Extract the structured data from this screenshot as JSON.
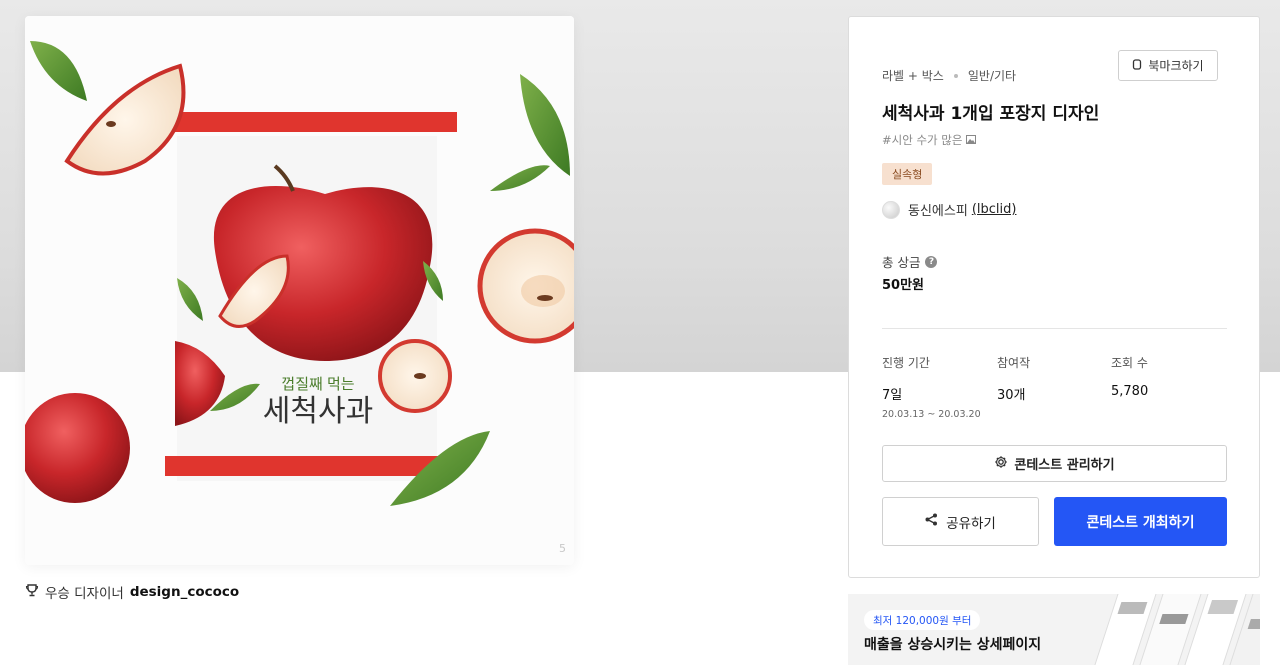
{
  "hero": {
    "package_slogan": "껍질째 먹는",
    "package_name": "세척사과",
    "brand_mark": "5"
  },
  "winner": {
    "label": "우승 디자이너",
    "designer": "design_cococo"
  },
  "contest": {
    "category": "라벨 + 박스",
    "subcategory": "일반/기타",
    "bookmark_label": "북마크하기",
    "title": "세척사과 1개입 포장지 디자인",
    "tagline": "#시안 수가 많은 ",
    "badge": "실속형",
    "host_name": "동신에스피",
    "host_handle": "(lbclid)",
    "prize_label": "총 상금",
    "prize_value": "50만원",
    "stats": [
      {
        "label": "진행 기간",
        "value": "7일",
        "sub": "20.03.13 ~ 20.03.20"
      },
      {
        "label": "참여작",
        "value": "30개"
      },
      {
        "label": "조회 수",
        "value": "5,780"
      }
    ],
    "manage_label": "콘테스트 관리하기",
    "share_label": "공유하기",
    "host_contest_label": "콘테스트 개최하기"
  },
  "promo": {
    "pill": "최저 120,000원 부터",
    "headline": "매출을 상승시키는 상세페이지"
  },
  "colors": {
    "primary": "#2456f5",
    "badge_bg": "#f7e0cf",
    "package_stripe": "#e0352e",
    "slogan_green": "#4b7d2c"
  },
  "icons": [
    "bookmark-icon",
    "help-icon",
    "gear-icon",
    "share-icon",
    "trophy-icon"
  ]
}
